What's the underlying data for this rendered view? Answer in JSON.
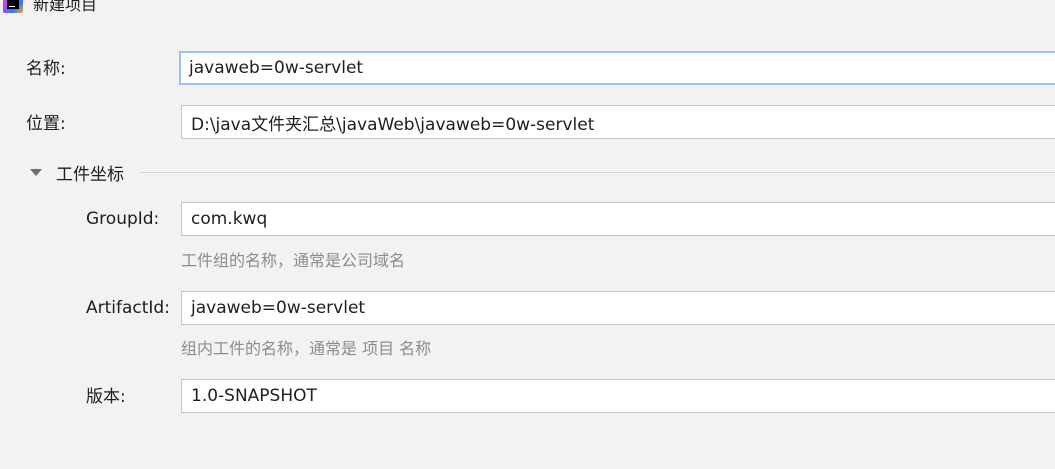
{
  "window": {
    "title": "新建项目",
    "icon": "intellij-idea-icon"
  },
  "form": {
    "name": {
      "label": "名称:",
      "value": "javaweb=0w-servlet"
    },
    "location": {
      "label": "位置:",
      "value": "D:\\java文件夹汇总\\javaWeb\\javaweb=0w-servlet"
    },
    "artifact_coordinates": {
      "section_title": "工件坐标",
      "expanded": true,
      "group_id": {
        "label": "GroupId:",
        "value": "com.kwq",
        "hint": "工件组的名称，通常是公司域名"
      },
      "artifact_id": {
        "label": "ArtifactId:",
        "value": "javaweb=0w-servlet",
        "hint": "组内工件的名称，通常是 项目 名称"
      },
      "version": {
        "label": "版本:",
        "value": "1.0-SNAPSHOT"
      }
    }
  },
  "colors": {
    "background": "#f2f2f2",
    "field_background": "#ffffff",
    "field_border": "#c6c6c6",
    "focus_border": "#97c3f3",
    "hint_text": "#8c8c8c"
  }
}
